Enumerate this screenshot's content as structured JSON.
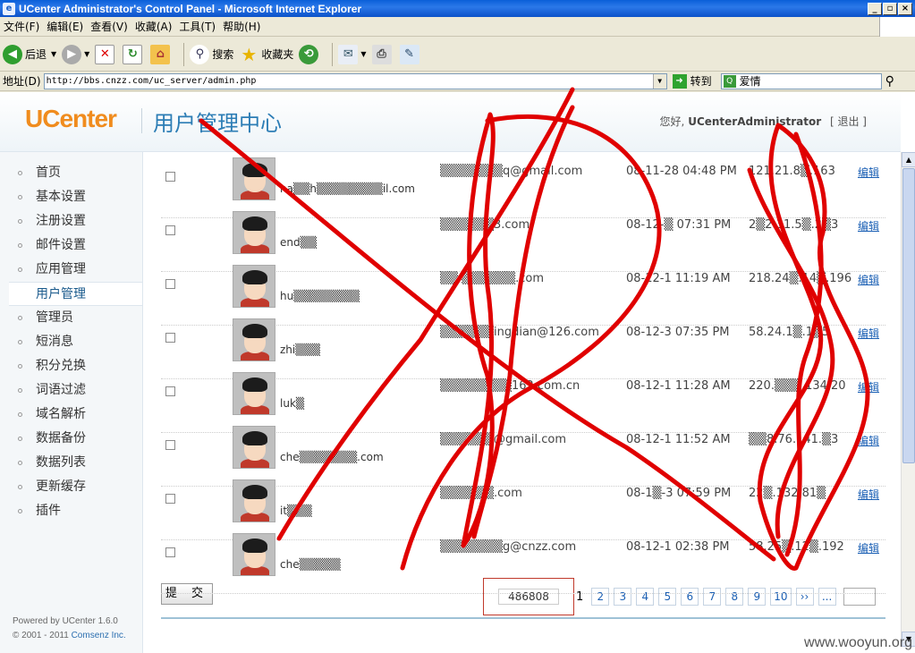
{
  "window": {
    "title": "UCenter Administrator's Control Panel - Microsoft Internet Explorer"
  },
  "menu": [
    "文件(F)",
    "编辑(E)",
    "查看(V)",
    "收藏(A)",
    "工具(T)",
    "帮助(H)"
  ],
  "toolbar": {
    "back": "后退",
    "search": "搜索",
    "favorites": "收藏夹"
  },
  "address": {
    "label": "地址(D)",
    "url": "http://bbs.cnzz.com/uc_server/admin.php",
    "go": "转到",
    "search_value": "爱情"
  },
  "header": {
    "logo": "UCenter",
    "title": "用户管理中心",
    "greeting": "您好,",
    "user": "UCenterAdministrator",
    "logout": "[ 退出 ]"
  },
  "sidebar": {
    "items": [
      "首页",
      "基本设置",
      "注册设置",
      "邮件设置",
      "应用管理",
      "用户管理",
      "管理员",
      "短消息",
      "积分兑换",
      "词语过滤",
      "域名解析",
      "数据备份",
      "数据列表",
      "更新缓存",
      "插件"
    ],
    "active_index": 5,
    "powered": "Powered by UCenter 1.6.0",
    "copyright": "© 2001 - 2011",
    "brand": "Comsenz Inc."
  },
  "users": [
    {
      "name": "na▒▒h▒▒▒▒▒▒▒▒il.com",
      "email": "▒▒▒▒▒▒▒q@gmail.com",
      "date": "08-11-28 04:48 PM",
      "ip": "121.21.8▒.163",
      "edit": "编辑"
    },
    {
      "name": "end▒▒",
      "email": "▒▒▒▒▒▒3.com",
      "date": "08-12-▒ 07:31 PM",
      "ip": "2▒2.31.5▒.2▒3",
      "edit": "编辑"
    },
    {
      "name": "hu▒▒▒▒▒▒▒▒",
      "email": "▒▒ ▒▒▒▒▒▒.com",
      "date": "08-12-1 11:19 AM",
      "ip": "218.24▒.14▒.196",
      "edit": "编辑"
    },
    {
      "name": "zhi▒▒▒",
      "email": "▒▒▒▒▒▒ingdian@126.com",
      "date": "08-12-3 07:35 PM",
      "ip": "58.24.1▒.1▒5",
      "edit": "编辑"
    },
    {
      "name": "luk▒",
      "email": "▒▒▒▒▒▒▒▒162.com.cn",
      "date": "08-12-1 11:28 AM",
      "ip": "220.▒▒▒.134.20",
      "edit": "编辑"
    },
    {
      "name": "che▒▒▒▒▒▒▒.com",
      "email": "▒▒▒▒▒▒@gmail.com",
      "date": "08-12-1 11:52 AM",
      "ip": "▒▒8.76.141.▒3",
      "edit": "编辑"
    },
    {
      "name": "it▒▒▒",
      "email": "▒▒▒▒▒▒.com",
      "date": "08-1▒-3 07:59 PM",
      "ip": "22▒.132.81▒",
      "edit": "编辑"
    },
    {
      "name": "che▒▒▒▒▒",
      "email": "▒▒▒▒▒▒▒g@cnzz.com",
      "date": "08-12-1 02:38 PM",
      "ip": "58.25▒.12▒.192",
      "edit": "编辑"
    }
  ],
  "footer": {
    "submit": "提 交",
    "total": "486808",
    "current_page": "1",
    "pages": [
      "2",
      "3",
      "4",
      "5",
      "6",
      "7",
      "8",
      "9",
      "10",
      "››",
      "..."
    ]
  },
  "watermark": "www.wooyun.org",
  "colors": {
    "ink": "#e00000",
    "accent": "#2c7db5",
    "logo": "#f08c1e",
    "link": "#1a5fb4"
  }
}
